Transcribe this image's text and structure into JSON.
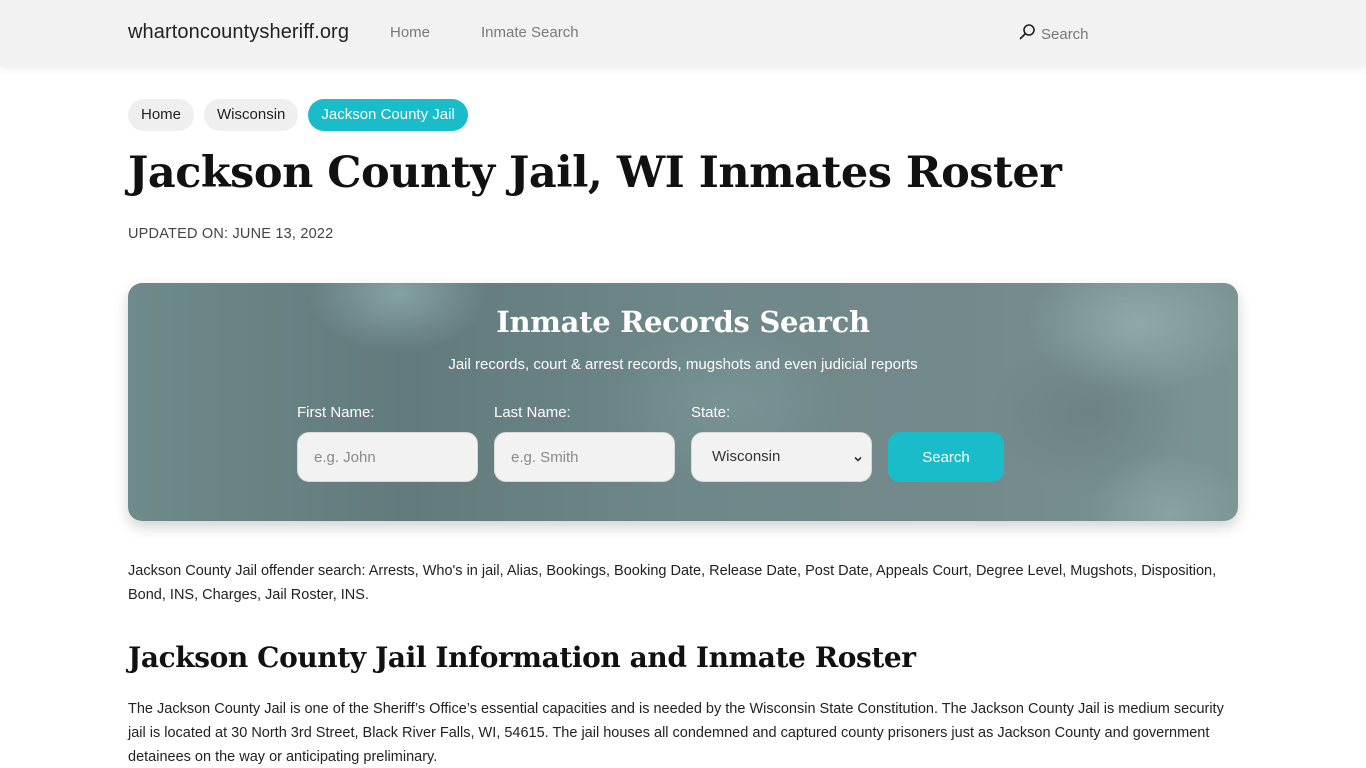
{
  "navbar": {
    "brand": "whartoncountysheriff.org",
    "links": [
      "Home",
      "Inmate Search"
    ],
    "search_label": "Search",
    "search_icon": "search-icon"
  },
  "breadcrumb": [
    "Home",
    "Wisconsin",
    "Jackson County Jail"
  ],
  "page": {
    "title": "Jackson County Jail, WI Inmates Roster",
    "updated": "UPDATED ON: JUNE 13, 2022"
  },
  "search_panel": {
    "title": "Inmate Records Search",
    "subtitle": "Jail records, court & arrest records, mugshots and even judicial reports",
    "first_name_label": "First Name:",
    "first_name_placeholder": "e.g. John",
    "first_name_value": "",
    "last_name_label": "Last Name:",
    "last_name_placeholder": "e.g. Smith",
    "last_name_value": "",
    "state_label": "State:",
    "state_selected": "Wisconsin",
    "button_label": "Search"
  },
  "content": {
    "intro": "Jackson County Jail offender search: Arrests, Who's in jail, Alias, Bookings, Booking Date, Release Date, Post Date, Appeals Court, Degree Level, Mugshots, Disposition, Bond, INS, Charges, Jail Roster, INS.",
    "section_title": "Jackson County Jail Information and Inmate Roster",
    "section_text": "The Jackson County Jail is one of the Sheriff’s Office’s essential capacities and is needed by the Wisconsin State Constitution. The Jackson County Jail is medium security jail is located at 30 North 3rd Street, Black River Falls, WI, 54615. The jail houses all condemned and captured county prisoners just as Jackson County and government detainees on the way or anticipating preliminary."
  },
  "colors": {
    "accent": "#1bbcc9",
    "navbar_bg": "#f2f2f2",
    "panel_base": "#6e8788"
  }
}
